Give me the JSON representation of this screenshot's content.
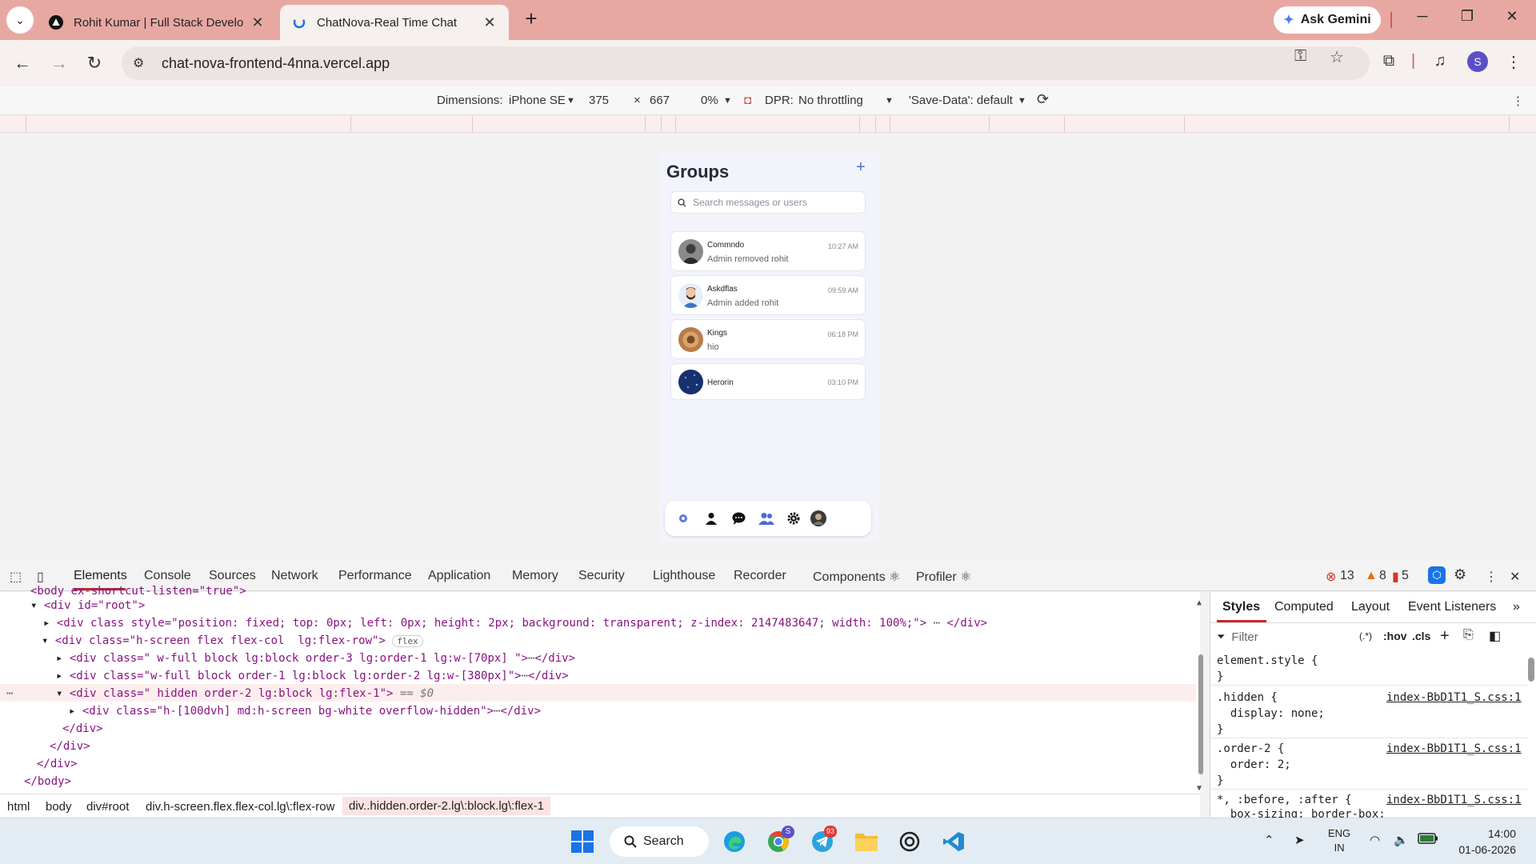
{
  "browser": {
    "tabs": [
      {
        "title": "Rohit Kumar | Full Stack Develo"
      },
      {
        "title": "ChatNova-Real Time Chat"
      }
    ],
    "gemini_label": "Ask Gemini",
    "url": "chat-nova-frontend-4nna.vercel.app",
    "profile_initial": "S"
  },
  "device_toolbar": {
    "dimensions_label": "Dimensions:",
    "device": "iPhone SE",
    "width": "375",
    "times": "×",
    "height": "667",
    "zoom": "0%",
    "dpr_label": "DPR:",
    "throttling": "No throttling",
    "save_data": "'Save-Data': default"
  },
  "app": {
    "title": "Groups",
    "add_symbol": "+",
    "search_placeholder": "Search messages or users",
    "chats": [
      {
        "name": "Commndo",
        "message": "Admin removed rohit",
        "time": "10:27 AM"
      },
      {
        "name": "Askdflas",
        "message": "Admin added rohit",
        "time": "09:59 AM"
      },
      {
        "name": "Kings",
        "message": "hio",
        "time": "06:18 PM"
      },
      {
        "name": "Herorin",
        "message": "",
        "time": "03:10 PM"
      }
    ]
  },
  "devtools": {
    "tabs": [
      "Elements",
      "Console",
      "Sources",
      "Network",
      "Performance",
      "Application",
      "Memory",
      "Security",
      "Lighthouse",
      "Recorder",
      "Components ⚛",
      "Profiler ⚛"
    ],
    "errors": "13",
    "warnings": "8",
    "issues": "5",
    "dom_lines": {
      "l0": "<body ex-shortcut-listen=\"true\">",
      "l1_tag": "<div id=\"root\">",
      "l2": "<div class style=\"position: fixed; top: 0px; left: 0px; height: 2px; background: transparent; z-index: 2147483647; width: 100%;\">",
      "l2_end": "</div>",
      "l3": "<div class=\"h-screen flex flex-col  lg:flex-row\">",
      "l3_badge": "flex",
      "l4": "<div class=\" w-full block lg:block order-3 lg:order-1 lg:w-[70px] \">",
      "l4_end": "</div>",
      "l5": "<div class=\"w-full block order-1 lg:block lg:order-2 lg:w-[380px]\">",
      "l5_end": "</div>",
      "l6": "<div class=\" hidden order-2 lg:block lg:flex-1\">",
      "l6_eq": " == $0",
      "l7": "<div class=\"h-[100dvh] md:h-screen bg-white overflow-hidden\">",
      "l7_end": "</div>",
      "l8": "</div>",
      "l9": "</div>",
      "l10": "</div>",
      "l11": "</body>"
    },
    "breadcrumbs": [
      "html",
      "body",
      "div#root",
      "div.h-screen.flex.flex-col.lg\\:flex-row",
      "div..hidden.order-2.lg\\:block.lg\\:flex-1"
    ],
    "styles": {
      "tabs": [
        "Styles",
        "Computed",
        "Layout",
        "Event Listeners",
        "»"
      ],
      "filter_placeholder": "Filter",
      "hov": ":hov",
      "cls": ".cls",
      "rule0_selector": "element.style {",
      "rule0_close": "}",
      "rule1_selector": ".hidden {",
      "rule1_prop": "  display: none;",
      "rule1_close": "}",
      "rule1_src": "index-BbD1T1_S.css:1",
      "rule2_selector": ".order-2 {",
      "rule2_prop": "  order: 2;",
      "rule2_close": "}",
      "rule2_src": "index-BbD1T1_S.css:1",
      "rule3_selector": "*, :before, :after {",
      "rule3_prop": "  box-sizing: border-box;",
      "rule3_src": "index-BbD1T1_S.css:1"
    }
  },
  "taskbar": {
    "search_label": "Search",
    "chrome_badge": "S",
    "telegram_badge": "93",
    "lang": "ENG",
    "region": "IN",
    "time": "14:00",
    "date": "01-06-2026"
  },
  "colors": {
    "tabstrip": "#e8a8a2",
    "accent_blue": "#4b6bd1",
    "devtools_red": "#c62828"
  }
}
